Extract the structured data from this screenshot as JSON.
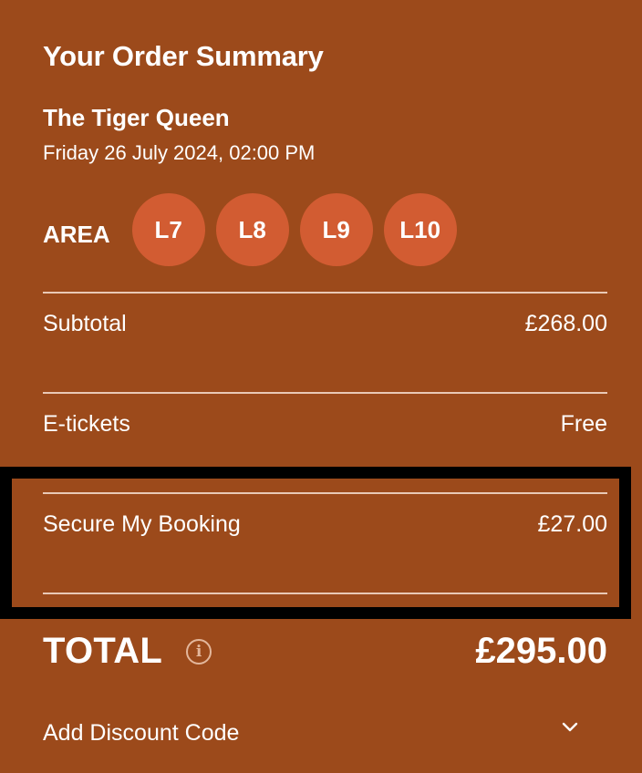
{
  "summary": {
    "heading": "Your Order Summary",
    "show_title": "The Tiger Queen",
    "show_date": "Friday 26 July 2024, 02:00 PM",
    "area_label": "AREA",
    "seats": [
      "L7",
      "L8",
      "L9",
      "L10"
    ]
  },
  "lines": {
    "subtotal_label": "Subtotal",
    "subtotal_value": "£268.00",
    "etickets_label": "E-tickets",
    "etickets_value": "Free",
    "secure_label": "Secure My Booking",
    "secure_value": "£27.00"
  },
  "total": {
    "label": "TOTAL",
    "info_icon": "info-icon",
    "value": "£295.00"
  },
  "discount": {
    "label": "Add Discount Code",
    "toggle_icon": "chevron-down-icon"
  },
  "colors": {
    "background": "#9c4a1b",
    "seat_badge": "#d25c32",
    "highlight_border": "#000000",
    "text": "#ffffff"
  }
}
